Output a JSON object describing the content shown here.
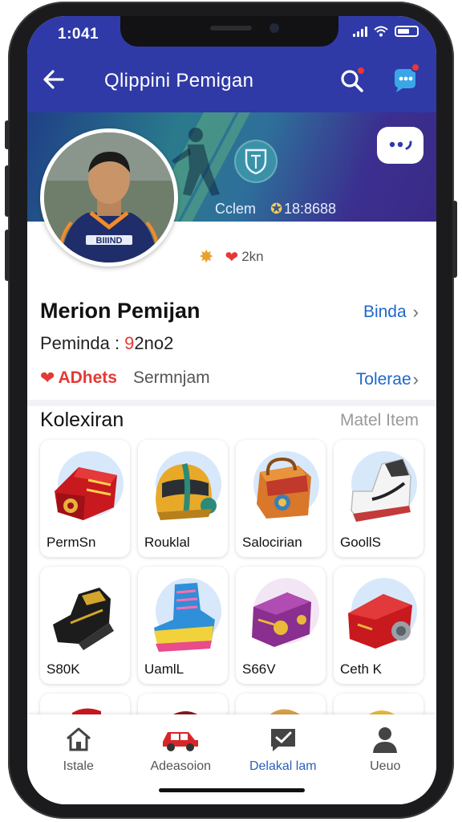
{
  "status_bar": {
    "time": "1:041"
  },
  "header": {
    "title": "Qlippini Pemigan"
  },
  "banner": {
    "stat_label": "Cclem",
    "stat_value": "18:8688"
  },
  "profile": {
    "mini_badge_text": "2kn",
    "name": "Merion Pemijan",
    "name_link": "Binda",
    "subtitle_prefix": "Peminda : ",
    "subtitle_value": "9",
    "subtitle_suffix": "2no2",
    "tag_primary": "ADhets",
    "tag_secondary": "Sermnjam",
    "tag_link": "Tolerae",
    "jersey_text": "BIIIND"
  },
  "collection": {
    "title": "Kolexiran",
    "link": "Matel Item",
    "items": [
      {
        "label": "PermSn",
        "icon": "red-kit-bag-icon"
      },
      {
        "label": "Rouklal",
        "icon": "helmet-icon"
      },
      {
        "label": "Salocirian",
        "icon": "backpack-icon"
      },
      {
        "label": "GoollS",
        "icon": "sneaker-icon"
      },
      {
        "label": "S80K",
        "icon": "black-cleat-icon"
      },
      {
        "label": "UamlL",
        "icon": "boot-icon"
      },
      {
        "label": "S66V",
        "icon": "purple-case-icon"
      },
      {
        "label": "Ceth K",
        "icon": "red-case-icon"
      }
    ]
  },
  "nav": {
    "items": [
      {
        "label": "Istale",
        "icon": "home-icon"
      },
      {
        "label": "Adeasoion",
        "icon": "car-icon"
      },
      {
        "label": "Delakal lam",
        "icon": "message-check-icon"
      },
      {
        "label": "Ueuo",
        "icon": "profile-icon"
      }
    ],
    "active_index": 2
  },
  "colors": {
    "header": "#2f3aa8",
    "accent_blue": "#1f67c9",
    "accent_red": "#e53935"
  }
}
